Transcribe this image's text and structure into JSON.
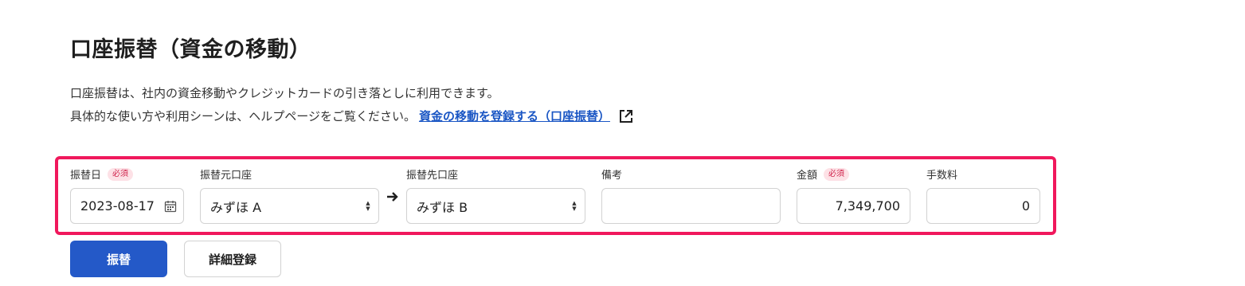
{
  "page": {
    "title": "口座振替（資金の移動）",
    "description_line1": "口座振替は、社内の資金移動やクレジットカードの引き落としに利用できます。",
    "description_line2": "具体的な使い方や利用シーンは、ヘルプページをご覧ください。",
    "help_link": "資金の移動を登録する（口座振替）"
  },
  "form": {
    "date": {
      "label": "振替日",
      "badge": "必須",
      "value": "2023-08-17"
    },
    "from_account": {
      "label": "振替元口座",
      "value": "みずほ A"
    },
    "to_account": {
      "label": "振替先口座",
      "value": "みずほ B"
    },
    "memo": {
      "label": "備考",
      "value": ""
    },
    "amount": {
      "label": "金額",
      "badge": "必須",
      "value": "7,349,700"
    },
    "fee": {
      "label": "手数料",
      "value": "0"
    }
  },
  "buttons": {
    "transfer": "振替",
    "detail": "詳細登録"
  },
  "colors": {
    "accent": "#2459c8",
    "highlight_border": "#f0185c",
    "link": "#1a56c4"
  }
}
